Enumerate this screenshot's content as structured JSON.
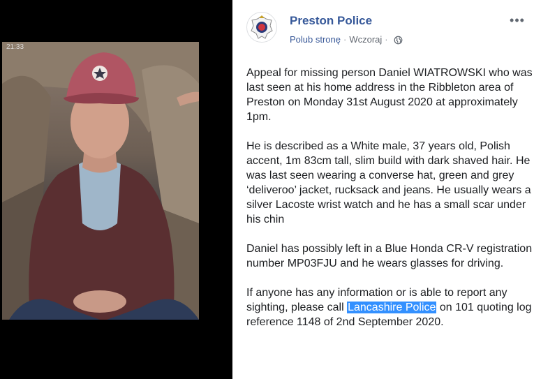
{
  "photo": {
    "status_time": "21:33",
    "alt": "Man wearing a red converse cap"
  },
  "post": {
    "page_name": "Preston Police",
    "like_label": "Polub stronę",
    "timestamp": "Wczoraj",
    "more_label": "•••",
    "paragraphs": [
      "Appeal for missing person Daniel WIATROWSKI who was last seen at his home address in the Ribbleton area of Preston on Monday 31st August 2020 at approximately 1pm.",
      "He is described as a White male, 37 years old, Polish accent, 1m 83cm tall, slim build with dark shaved hair. He was last seen wearing a converse hat, green and grey ‘deliveroo’ jacket, rucksack and jeans. He usually wears a silver Lacoste wrist watch and he has a small scar under his chin",
      "Daniel has possibly left in a Blue Honda CR-V registration number MP03FJU and he wears glasses for driving."
    ],
    "last_paragraph": {
      "before": "If anyone has any information or is able to report any sighting, please call ",
      "highlight": "Lancashire Police",
      "after": " on 101 quoting log reference 1148 of 2nd September 2020."
    }
  },
  "colors": {
    "link": "#365899",
    "text": "#1c1e21",
    "highlight": "#3390ff"
  }
}
